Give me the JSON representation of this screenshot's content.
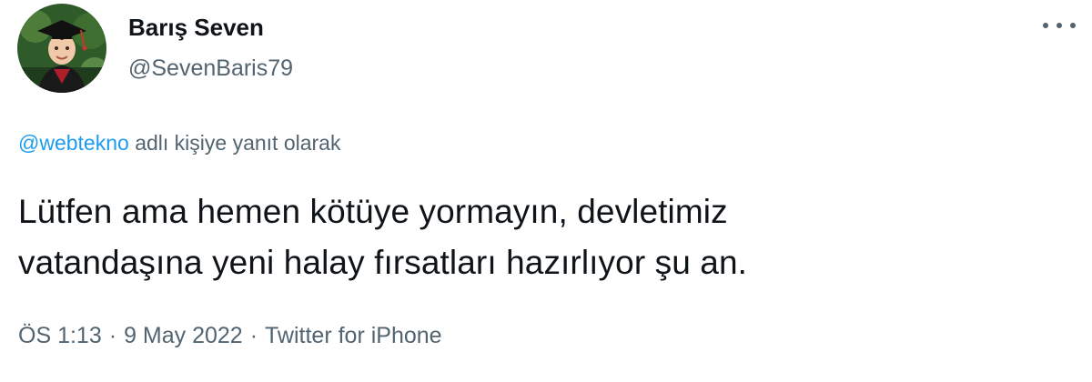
{
  "user": {
    "display_name": "Barış Seven",
    "handle": "@SevenBaris79"
  },
  "reply": {
    "mention": "@webtekno",
    "suffix": " adlı kişiye yanıt olarak"
  },
  "tweet": {
    "line1": "Lütfen ama hemen kötüye yormayın, devletimiz",
    "line2": "vatandaşına yeni halay fırsatları hazırlıyor şu an."
  },
  "meta": {
    "time": "ÖS 1:13",
    "separator": "·",
    "date": "9 May 2022",
    "source": "Twitter for iPhone"
  },
  "icons": {
    "more": "more-horizontal-icon"
  },
  "colors": {
    "link": "#1d9bf0",
    "secondary_text": "#536471",
    "primary_text": "#0f1419"
  }
}
